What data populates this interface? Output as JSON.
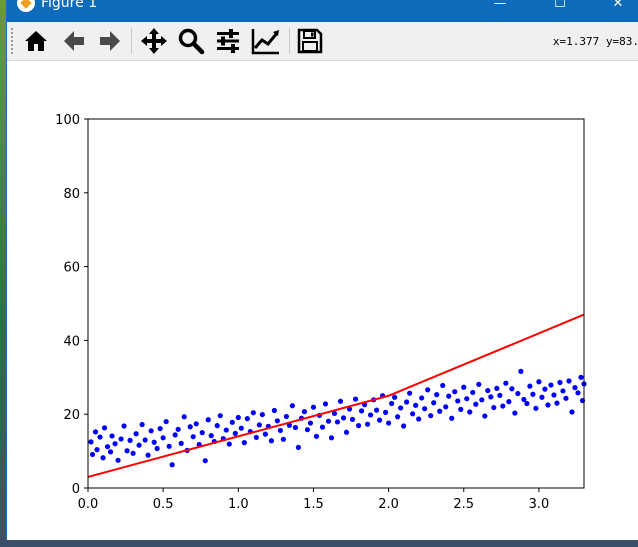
{
  "window": {
    "title": "Figure 1",
    "minimize_glyph": "—",
    "maximize_glyph": "☐",
    "close_glyph": "✕"
  },
  "toolbar": {
    "buttons": [
      {
        "icon": "home-icon"
      },
      {
        "icon": "back-arrow-icon"
      },
      {
        "icon": "forward-arrow-icon"
      },
      {
        "icon": "pan-icon"
      },
      {
        "icon": "zoom-icon"
      },
      {
        "icon": "subplots-config-icon"
      },
      {
        "icon": "edit-axis-icon"
      },
      {
        "icon": "save-icon"
      }
    ],
    "coords_text": "x=1.377 y=83."
  },
  "chart_data": {
    "type": "scatter",
    "title": "",
    "xlabel": "",
    "ylabel": "",
    "xlim": [
      0.0,
      3.3
    ],
    "ylim": [
      0,
      100
    ],
    "xticks": [
      "0.0",
      "0.5",
      "1.0",
      "1.5",
      "2.0",
      "2.5",
      "3.0"
    ],
    "yticks": [
      "0",
      "20",
      "40",
      "60",
      "80",
      "100"
    ],
    "grid": false,
    "series": [
      {
        "kind": "scatter",
        "color": "#0000ff",
        "note_trend": "points follow y ≈ 4.6x + 10 with noise ±6",
        "points": [
          [
            0.02,
            12.5
          ],
          [
            0.03,
            9.1
          ],
          [
            0.05,
            15.2
          ],
          [
            0.06,
            10.4
          ],
          [
            0.08,
            13.8
          ],
          [
            0.1,
            8.2
          ],
          [
            0.11,
            16.3
          ],
          [
            0.13,
            11.2
          ],
          [
            0.15,
            9.8
          ],
          [
            0.16,
            14.1
          ],
          [
            0.18,
            12.0
          ],
          [
            0.2,
            7.5
          ],
          [
            0.22,
            13.3
          ],
          [
            0.24,
            16.8
          ],
          [
            0.26,
            10.1
          ],
          [
            0.28,
            12.9
          ],
          [
            0.3,
            9.4
          ],
          [
            0.32,
            14.7
          ],
          [
            0.34,
            11.6
          ],
          [
            0.36,
            17.2
          ],
          [
            0.38,
            13.0
          ],
          [
            0.4,
            8.9
          ],
          [
            0.42,
            15.5
          ],
          [
            0.44,
            12.4
          ],
          [
            0.46,
            10.7
          ],
          [
            0.48,
            16.1
          ],
          [
            0.5,
            13.6
          ],
          [
            0.52,
            18.0
          ],
          [
            0.54,
            11.3
          ],
          [
            0.56,
            6.3
          ],
          [
            0.58,
            14.4
          ],
          [
            0.6,
            15.9
          ],
          [
            0.62,
            12.1
          ],
          [
            0.64,
            19.3
          ],
          [
            0.66,
            10.2
          ],
          [
            0.68,
            16.6
          ],
          [
            0.7,
            13.9
          ],
          [
            0.72,
            17.4
          ],
          [
            0.74,
            11.8
          ],
          [
            0.76,
            15.0
          ],
          [
            0.78,
            7.4
          ],
          [
            0.8,
            18.5
          ],
          [
            0.82,
            14.2
          ],
          [
            0.84,
            12.6
          ],
          [
            0.86,
            16.9
          ],
          [
            0.88,
            19.6
          ],
          [
            0.9,
            13.4
          ],
          [
            0.92,
            15.7
          ],
          [
            0.94,
            11.9
          ],
          [
            0.96,
            17.8
          ],
          [
            0.98,
            14.8
          ],
          [
            1.0,
            19.1
          ],
          [
            1.02,
            16.2
          ],
          [
            1.04,
            12.3
          ],
          [
            1.06,
            18.8
          ],
          [
            1.08,
            15.3
          ],
          [
            1.1,
            20.4
          ],
          [
            1.12,
            13.7
          ],
          [
            1.14,
            17.1
          ],
          [
            1.16,
            19.9
          ],
          [
            1.18,
            14.6
          ],
          [
            1.2,
            16.7
          ],
          [
            1.22,
            12.8
          ],
          [
            1.24,
            21.0
          ],
          [
            1.26,
            18.2
          ],
          [
            1.28,
            15.6
          ],
          [
            1.3,
            13.2
          ],
          [
            1.32,
            19.4
          ],
          [
            1.34,
            17.0
          ],
          [
            1.36,
            22.3
          ],
          [
            1.38,
            16.4
          ],
          [
            1.4,
            11.0
          ],
          [
            1.42,
            18.9
          ],
          [
            1.44,
            20.7
          ],
          [
            1.46,
            15.8
          ],
          [
            1.48,
            17.6
          ],
          [
            1.5,
            21.9
          ],
          [
            1.52,
            14.0
          ],
          [
            1.54,
            19.7
          ],
          [
            1.56,
            16.5
          ],
          [
            1.58,
            22.8
          ],
          [
            1.6,
            18.1
          ],
          [
            1.62,
            13.6
          ],
          [
            1.64,
            20.2
          ],
          [
            1.66,
            17.9
          ],
          [
            1.68,
            23.5
          ],
          [
            1.7,
            19.0
          ],
          [
            1.72,
            15.1
          ],
          [
            1.74,
            21.4
          ],
          [
            1.76,
            18.6
          ],
          [
            1.78,
            24.1
          ],
          [
            1.8,
            16.9
          ],
          [
            1.82,
            20.9
          ],
          [
            1.84,
            22.6
          ],
          [
            1.86,
            17.3
          ],
          [
            1.88,
            19.8
          ],
          [
            1.9,
            23.9
          ],
          [
            1.92,
            21.1
          ],
          [
            1.94,
            18.4
          ],
          [
            1.96,
            25.0
          ],
          [
            1.98,
            20.5
          ],
          [
            2.0,
            17.6
          ],
          [
            2.02,
            22.9
          ],
          [
            2.04,
            24.6
          ],
          [
            2.06,
            19.3
          ],
          [
            2.08,
            21.7
          ],
          [
            2.1,
            16.8
          ],
          [
            2.12,
            23.3
          ],
          [
            2.14,
            25.7
          ],
          [
            2.16,
            20.1
          ],
          [
            2.18,
            22.4
          ],
          [
            2.2,
            18.7
          ],
          [
            2.22,
            24.4
          ],
          [
            2.24,
            21.5
          ],
          [
            2.26,
            26.6
          ],
          [
            2.28,
            19.6
          ],
          [
            2.3,
            23.1
          ],
          [
            2.32,
            25.3
          ],
          [
            2.34,
            20.8
          ],
          [
            2.36,
            27.8
          ],
          [
            2.38,
            22.0
          ],
          [
            2.4,
            24.9
          ],
          [
            2.42,
            18.9
          ],
          [
            2.44,
            26.1
          ],
          [
            2.46,
            23.6
          ],
          [
            2.48,
            21.3
          ],
          [
            2.5,
            27.3
          ],
          [
            2.52,
            24.2
          ],
          [
            2.54,
            20.6
          ],
          [
            2.56,
            25.9
          ],
          [
            2.58,
            22.7
          ],
          [
            2.6,
            28.1
          ],
          [
            2.62,
            23.9
          ],
          [
            2.64,
            19.5
          ],
          [
            2.66,
            26.4
          ],
          [
            2.68,
            24.7
          ],
          [
            2.7,
            21.8
          ],
          [
            2.72,
            27.0
          ],
          [
            2.74,
            25.1
          ],
          [
            2.76,
            22.2
          ],
          [
            2.78,
            28.4
          ],
          [
            2.8,
            23.4
          ],
          [
            2.82,
            26.9
          ],
          [
            2.84,
            20.3
          ],
          [
            2.86,
            25.6
          ],
          [
            2.88,
            31.6
          ],
          [
            2.9,
            24.0
          ],
          [
            2.92,
            22.9
          ],
          [
            2.94,
            27.6
          ],
          [
            2.96,
            25.4
          ],
          [
            2.98,
            21.6
          ],
          [
            3.0,
            28.8
          ],
          [
            3.02,
            24.6
          ],
          [
            3.04,
            26.8
          ],
          [
            3.06,
            22.5
          ],
          [
            3.08,
            27.9
          ],
          [
            3.1,
            25.2
          ],
          [
            3.12,
            23.0
          ],
          [
            3.14,
            28.6
          ],
          [
            3.16,
            26.3
          ],
          [
            3.18,
            24.3
          ],
          [
            3.2,
            29.0
          ],
          [
            3.22,
            20.6
          ],
          [
            3.24,
            27.2
          ],
          [
            3.26,
            25.8
          ],
          [
            3.28,
            30.0
          ],
          [
            3.29,
            23.7
          ],
          [
            3.3,
            28.2
          ]
        ]
      },
      {
        "kind": "line",
        "color": "#ff0000",
        "points": [
          [
            0.0,
            3.0
          ],
          [
            2.0,
            25.0
          ],
          [
            3.3,
            47.0
          ]
        ]
      }
    ]
  }
}
